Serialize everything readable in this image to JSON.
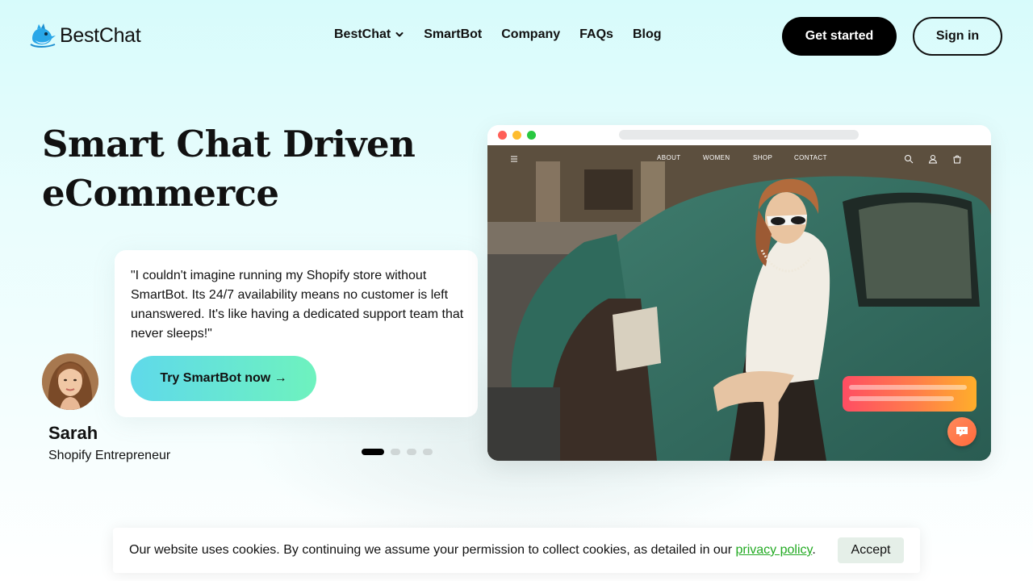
{
  "brand": {
    "name": "BestChat",
    "logo_icon": "bird-icon"
  },
  "nav": {
    "items": [
      {
        "label": "BestChat",
        "has_dropdown": true
      },
      {
        "label": "SmartBot"
      },
      {
        "label": "Company"
      },
      {
        "label": "FAQs"
      },
      {
        "label": "Blog"
      }
    ]
  },
  "header": {
    "get_started_label": "Get started",
    "sign_in_label": "Sign in"
  },
  "hero": {
    "title_line1": "Smart Chat Driven",
    "title_line2": "eCommerce"
  },
  "testimonial": {
    "quote": "\"I couldn't imagine running my Shopify store without SmartBot. Its 24/7 availability means no customer is left unanswered. It's like having a dedicated support team that never sleeps!\"",
    "cta_label": "Try SmartBot now →",
    "author_name": "Sarah",
    "author_role": "Shopify Entrepreneur",
    "carousel": {
      "total": 4,
      "active": 1
    }
  },
  "mockup": {
    "site_nav": [
      "ABOUT",
      "WOMEN",
      "SHOP",
      "CONTACT"
    ]
  },
  "cookie": {
    "text": "Our website uses cookies. By continuing we assume your permission to collect cookies, as detailed in our ",
    "link_label": "privacy policy",
    "suffix": ".",
    "accept_label": "Accept"
  },
  "colors": {
    "background": "#d7fbfb",
    "primary_button": "#000000",
    "cta_gradient_start": "#5fd9ea",
    "cta_gradient_end": "#6ef2be",
    "cookie_link": "#22aa22",
    "chat_widget_start": "#ff4d63",
    "chat_widget_end": "#ffae2a"
  }
}
